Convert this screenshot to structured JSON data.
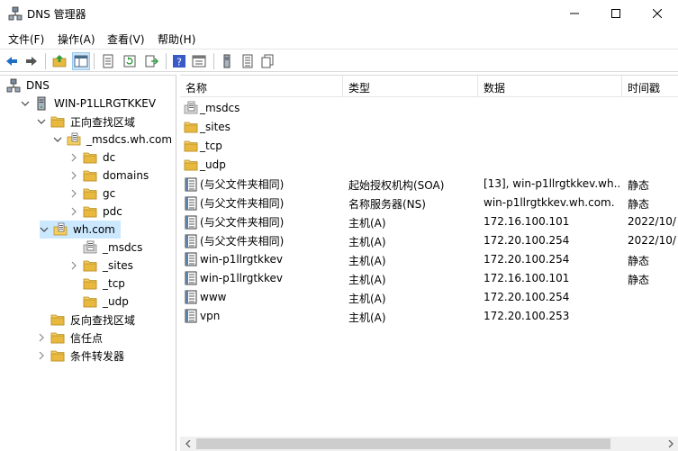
{
  "window": {
    "title": "DNS 管理器"
  },
  "menu": [
    "文件(F)",
    "操作(A)",
    "查看(V)",
    "帮助(H)"
  ],
  "toolbar": [
    "back-icon",
    "forward-icon",
    "up-folder-icon",
    "show-tree-icon",
    "properties-icon",
    "refresh-icon",
    "export-icon",
    "help-icon",
    "console-icon",
    "server-icon",
    "list-icon",
    "copy-icon"
  ],
  "tree": [
    {
      "label": "DNS",
      "icon": "dns-icon",
      "expander": "none"
    },
    {
      "label": "WIN-P1LLRGTKKEV",
      "icon": "server-icon",
      "expander": "expanded"
    },
    {
      "label": "正向查找区域",
      "icon": "folder-icon",
      "expander": "expanded"
    },
    {
      "label": "_msdcs.wh.com",
      "icon": "zone-icon",
      "expander": "expanded"
    },
    {
      "label": "dc",
      "icon": "folder-icon",
      "expander": "collapsed"
    },
    {
      "label": "domains",
      "icon": "folder-icon",
      "expander": "collapsed"
    },
    {
      "label": "gc",
      "icon": "folder-icon",
      "expander": "collapsed"
    },
    {
      "label": "pdc",
      "icon": "folder-icon",
      "expander": "collapsed"
    },
    {
      "label": "wh.com",
      "icon": "zone-icon",
      "expander": "expanded"
    },
    {
      "label": "_msdcs",
      "icon": "delegation-icon",
      "expander": "none"
    },
    {
      "label": "_sites",
      "icon": "folder-icon",
      "expander": "collapsed"
    },
    {
      "label": "_tcp",
      "icon": "folder-icon",
      "expander": "none"
    },
    {
      "label": "_udp",
      "icon": "folder-icon",
      "expander": "none"
    },
    {
      "label": "反向查找区域",
      "icon": "folder-icon",
      "expander": "none"
    },
    {
      "label": "信任点",
      "icon": "folder-icon",
      "expander": "collapsed"
    },
    {
      "label": "条件转发器",
      "icon": "folder-icon",
      "expander": "collapsed"
    }
  ],
  "columns": [
    "名称",
    "类型",
    "数据",
    "时间戳"
  ],
  "records": [
    {
      "icon": "delegation-icon",
      "name": "_msdcs",
      "type": "",
      "data": "",
      "timestamp": ""
    },
    {
      "icon": "folder-icon",
      "name": "_sites",
      "type": "",
      "data": "",
      "timestamp": ""
    },
    {
      "icon": "folder-icon",
      "name": "_tcp",
      "type": "",
      "data": "",
      "timestamp": ""
    },
    {
      "icon": "folder-icon",
      "name": "_udp",
      "type": "",
      "data": "",
      "timestamp": ""
    },
    {
      "icon": "record-icon",
      "name": "(与父文件夹相同)",
      "type": "起始授权机构(SOA)",
      "data": "[13], win-p1llrgtkkev.wh....",
      "timestamp": "静态"
    },
    {
      "icon": "record-icon",
      "name": "(与父文件夹相同)",
      "type": "名称服务器(NS)",
      "data": "win-p1llrgtkkev.wh.com.",
      "timestamp": "静态"
    },
    {
      "icon": "record-icon",
      "name": "(与父文件夹相同)",
      "type": "主机(A)",
      "data": "172.16.100.101",
      "timestamp": "2022/10/"
    },
    {
      "icon": "record-icon",
      "name": "(与父文件夹相同)",
      "type": "主机(A)",
      "data": "172.20.100.254",
      "timestamp": "2022/10/"
    },
    {
      "icon": "record-icon",
      "name": "win-p1llrgtkkev",
      "type": "主机(A)",
      "data": "172.20.100.254",
      "timestamp": "静态"
    },
    {
      "icon": "record-icon",
      "name": "win-p1llrgtkkev",
      "type": "主机(A)",
      "data": "172.16.100.101",
      "timestamp": "静态"
    },
    {
      "icon": "record-icon",
      "name": "www",
      "type": "主机(A)",
      "data": "172.20.100.254",
      "timestamp": ""
    },
    {
      "icon": "record-icon",
      "name": "vpn",
      "type": "主机(A)",
      "data": "172.20.100.253",
      "timestamp": ""
    }
  ],
  "colors": {
    "selection": "#cce8ff",
    "folder": "#e8b93e",
    "toolbar_pressed": "#cce4f7"
  }
}
